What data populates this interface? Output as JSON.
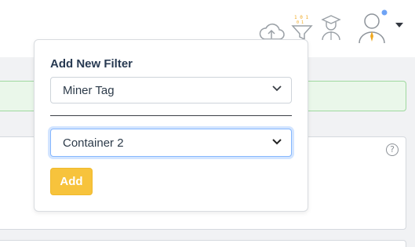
{
  "header": {
    "icons": [
      "cloud-upload-icon",
      "filter-funnel-icon",
      "graduate-icon",
      "user-avatar-icon",
      "caret-down-icon"
    ],
    "notification_dot_color": "#6ea3f5"
  },
  "help": {
    "glyph": "?"
  },
  "popover": {
    "title": "Add New Filter",
    "filter_type": {
      "selected": "Miner Tag"
    },
    "filter_value": {
      "selected": "Container 2"
    },
    "add_label": "Add"
  },
  "colors": {
    "accent_button": "#f7c33c",
    "title_text": "#283a52",
    "alert_bg": "#eaf7ea",
    "alert_border": "#9fd89f",
    "focus_ring": "#86b7fe"
  }
}
